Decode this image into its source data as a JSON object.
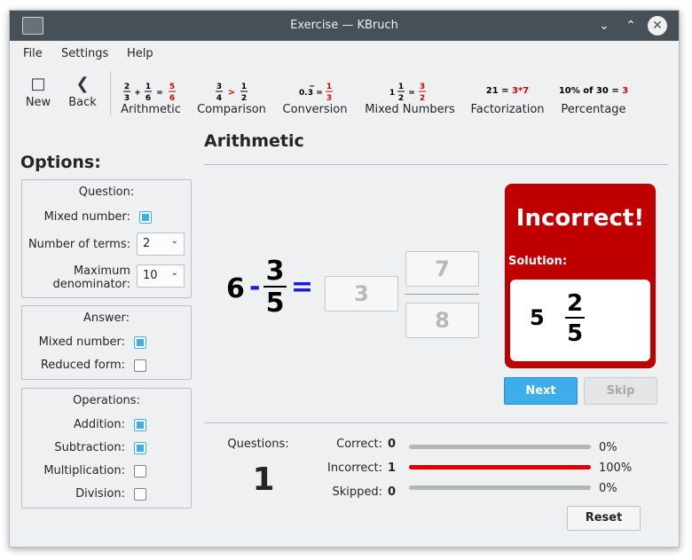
{
  "window": {
    "title": "Exercise — KBruch"
  },
  "menu": {
    "file": "File",
    "settings": "Settings",
    "help": "Help"
  },
  "toolbar": {
    "new": "New",
    "back": "Back",
    "exercises": [
      {
        "label": "Arithmetic",
        "preview": "2/3 + 1/6 = 5/6"
      },
      {
        "label": "Comparison",
        "preview": "3/4 > 1/2"
      },
      {
        "label": "Conversion",
        "preview": "0.3̄ = 1/3"
      },
      {
        "label": "Mixed Numbers",
        "preview": "1 1/2 = 3/2"
      },
      {
        "label": "Factorization",
        "preview_left": "21 =",
        "preview_right": "3*7"
      },
      {
        "label": "Percentage",
        "preview_left": "10% of 30 =",
        "preview_right": "3"
      }
    ]
  },
  "options": {
    "title": "Options:",
    "question": {
      "title": "Question:",
      "mixed_number_label": "Mixed number:",
      "mixed_number_checked": true,
      "terms_label": "Number of terms:",
      "terms_value": "2",
      "maxden_label_1": "Maximum",
      "maxden_label_2": "denominator:",
      "maxden_value": "10"
    },
    "answer": {
      "title": "Answer:",
      "mixed_number_label": "Mixed number:",
      "mixed_number_checked": true,
      "reduced_label": "Reduced form:",
      "reduced_checked": false
    },
    "operations": {
      "title": "Operations:",
      "addition": "Addition:",
      "subtraction": "Subtraction:",
      "multiplication": "Multiplication:",
      "division": "Division:"
    }
  },
  "exercise": {
    "title": "Arithmetic",
    "whole": "6",
    "operator": "-",
    "num": "3",
    "den": "5",
    "equals": "=",
    "answer_whole": "3",
    "answer_num": "7",
    "answer_den": "8",
    "result_title": "Incorrect!",
    "solution_label": "Solution:",
    "solution_whole": "5",
    "solution_num": "2",
    "solution_den": "5",
    "next": "Next",
    "skip": "Skip"
  },
  "stats": {
    "questions_label": "Questions:",
    "questions_value": "1",
    "correct_label": "Correct:",
    "correct_value": "0",
    "correct_pct": "0%",
    "correct_fraction": 0,
    "incorrect_label": "Incorrect:",
    "incorrect_value": "1",
    "incorrect_pct": "100%",
    "incorrect_fraction": 1,
    "skipped_label": "Skipped:",
    "skipped_value": "0",
    "skipped_pct": "0%",
    "skipped_fraction": 0,
    "reset": "Reset"
  },
  "colors": {
    "accent": "#3daee9",
    "incorrect": "#c00000",
    "bar_red": "#e00000"
  }
}
